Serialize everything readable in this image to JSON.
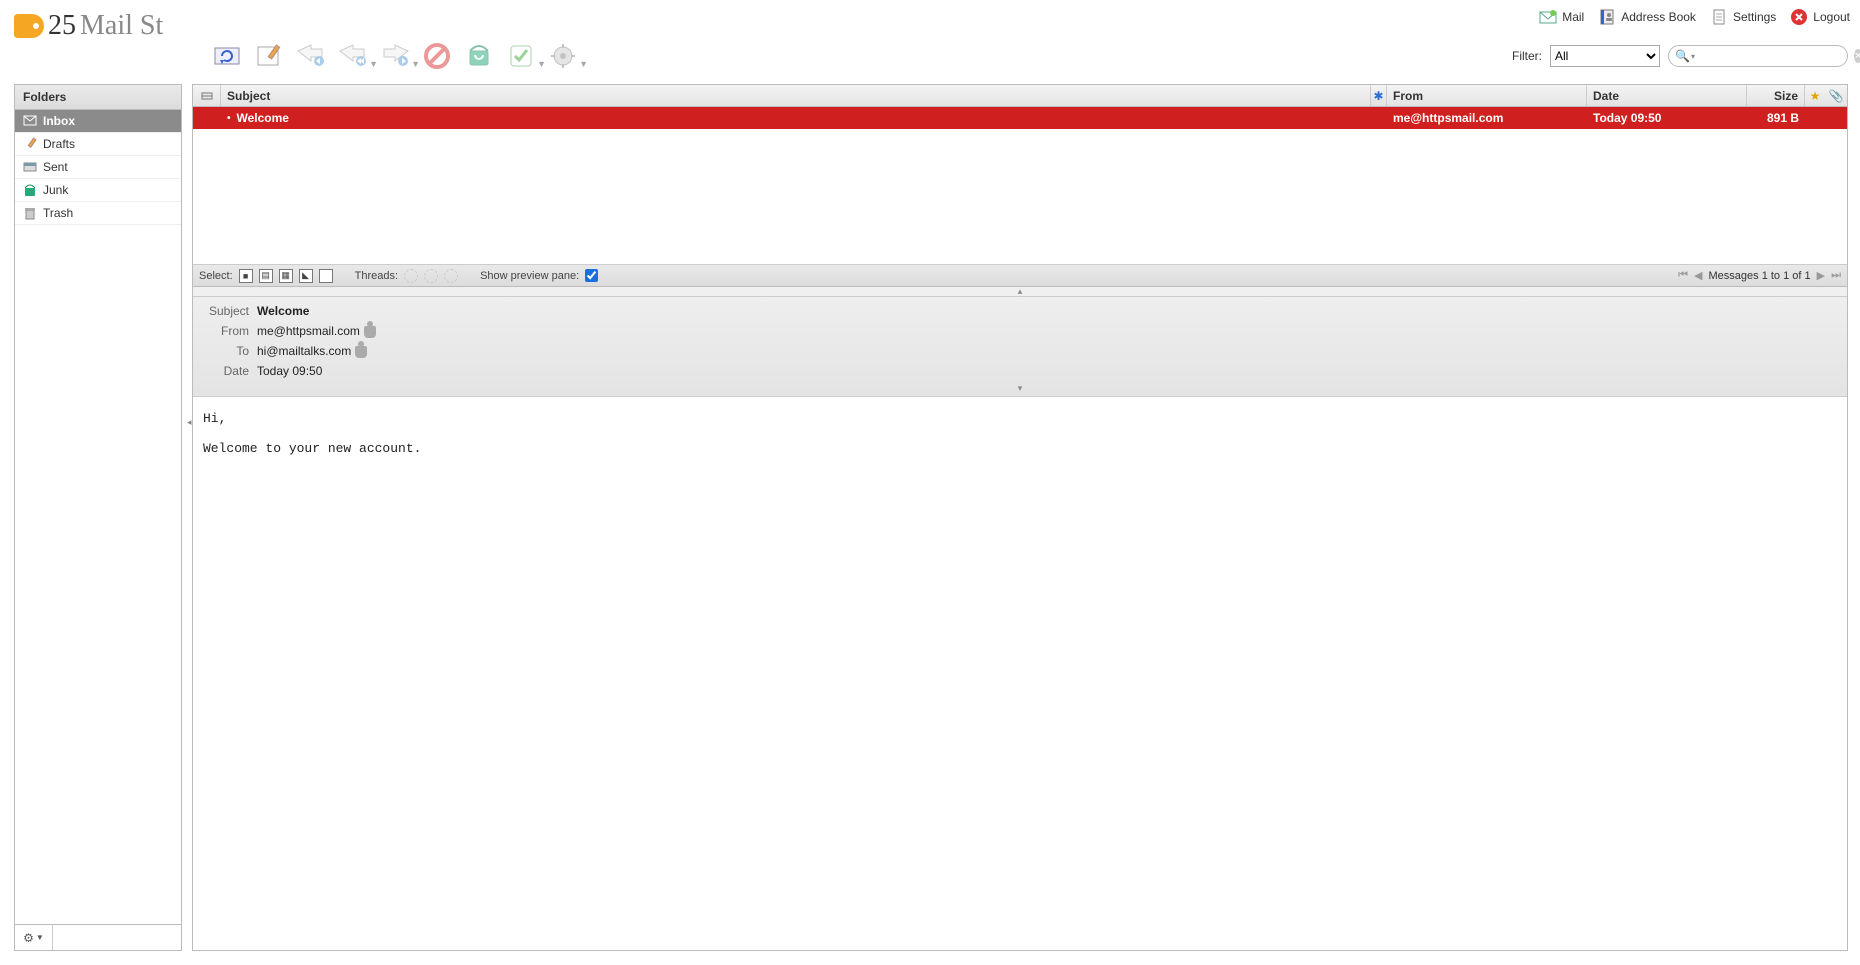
{
  "app": {
    "logo_25": "25",
    "logo_mailst": "Mail St"
  },
  "topnav": {
    "mail": "Mail",
    "address_book": "Address Book",
    "settings": "Settings",
    "logout": "Logout"
  },
  "toolbar": {
    "filter_label": "Filter:",
    "filter_value": "All",
    "search_placeholder": ""
  },
  "folders": {
    "header": "Folders",
    "items": [
      {
        "id": "inbox",
        "label": "Inbox",
        "active": true
      },
      {
        "id": "drafts",
        "label": "Drafts"
      },
      {
        "id": "sent",
        "label": "Sent"
      },
      {
        "id": "junk",
        "label": "Junk"
      },
      {
        "id": "trash",
        "label": "Trash"
      }
    ]
  },
  "messages": {
    "columns": {
      "subject": "Subject",
      "from": "From",
      "date": "Date",
      "size": "Size"
    },
    "rows": [
      {
        "subject": "Welcome",
        "from": "me@httpsmail.com",
        "date": "Today 09:50",
        "size": "891 B",
        "selected": true
      }
    ]
  },
  "selectbar": {
    "select_label": "Select:",
    "threads_label": "Threads:",
    "preview_label": "Show preview pane:",
    "preview_checked": true,
    "pager_text": "Messages 1 to 1 of 1"
  },
  "preview": {
    "labels": {
      "subject": "Subject",
      "from": "From",
      "to": "To",
      "date": "Date"
    },
    "subject": "Welcome",
    "from": "me@httpsmail.com",
    "to": "hi@mailtalks.com",
    "date": "Today 09:50",
    "body": "Hi,\n\nWelcome to your new account."
  }
}
